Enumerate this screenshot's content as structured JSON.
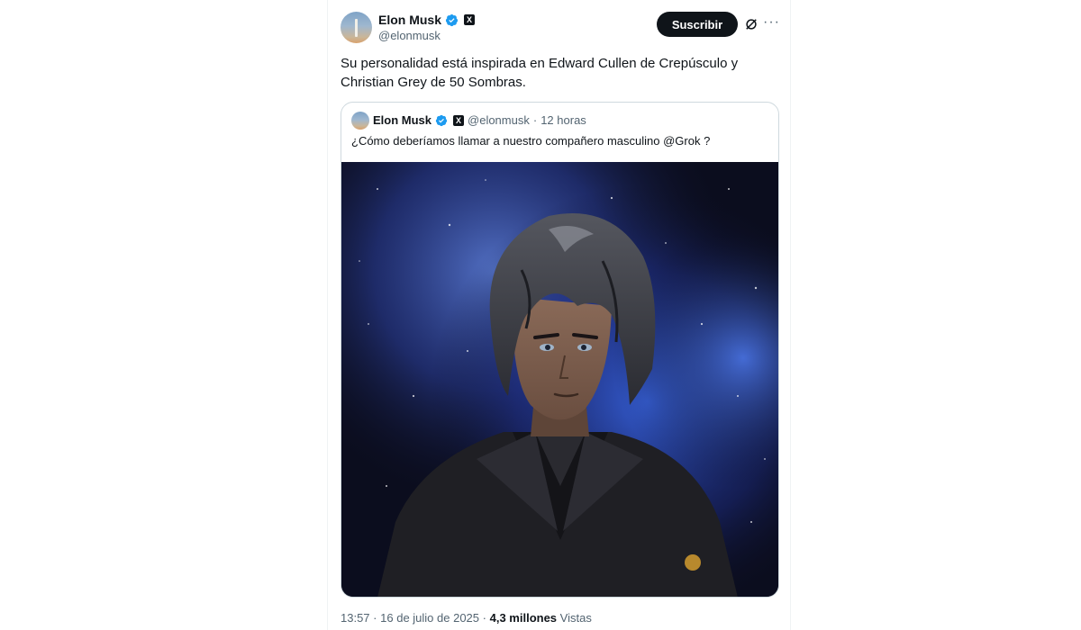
{
  "author": {
    "display_name": "Elon Musk",
    "handle": "@elonmusk",
    "x_badge": "X"
  },
  "actions": {
    "subscribe_label": "Suscribir",
    "more_label": "···"
  },
  "tweet": {
    "text_line1": "Su personalidad está inspirada en Edward Cullen de Crepúsculo y",
    "text_line2": "Christian Grey de 50 Sombras."
  },
  "quoted_tweet": {
    "display_name": "Elon Musk",
    "handle": "@elonmusk",
    "separator": "·",
    "time": "12 horas",
    "text": "¿Cómo deberíamos llamar a nuestro compañero masculino @Grok ?",
    "image_alt": "Anime-style man with dark hair in a black suit against a starry blue nebula"
  },
  "meta": {
    "time": "13:57",
    "separator": "·",
    "date": "16 de julio de 2025",
    "views_count": "4,3 millones",
    "views_label": "Vistas"
  },
  "colors": {
    "verified": "#1d9bf0",
    "text_primary": "#0f1419",
    "text_secondary": "#536471",
    "border": "#cfd9de",
    "button_bg": "#0f1419"
  }
}
